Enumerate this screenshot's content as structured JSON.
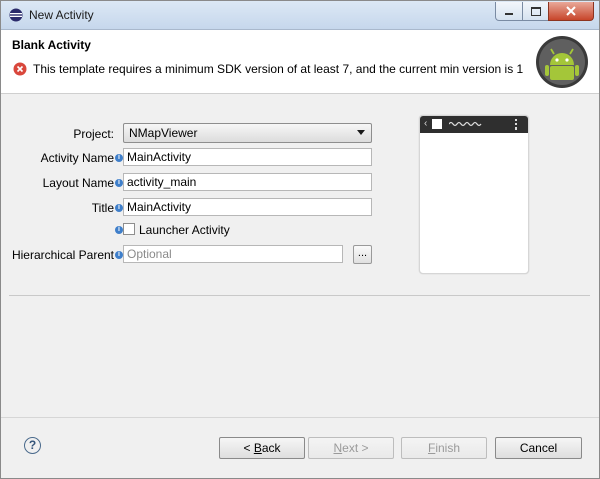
{
  "window": {
    "title": "New Activity"
  },
  "header": {
    "title": "Blank Activity",
    "error_message": "This template requires a minimum SDK version of at least 7, and the current min version is 1"
  },
  "form": {
    "project_label": "Project:",
    "project_value": "NMapViewer",
    "activity_name_label": "Activity Name",
    "activity_name_value": "MainActivity",
    "layout_name_label": "Layout Name",
    "layout_name_value": "activity_main",
    "title_label": "Title",
    "title_value": "MainActivity",
    "launcher_label": "Launcher Activity",
    "launcher_checked": false,
    "hierarchical_parent_label": "Hierarchical Parent",
    "hierarchical_parent_placeholder": "Optional",
    "browse_label": "..."
  },
  "buttons": {
    "help": "?",
    "back_prefix": "< ",
    "back_mnemonic": "B",
    "back_rest": "ack",
    "next_prefix": "",
    "next_mnemonic": "N",
    "next_rest": "ext >",
    "finish_prefix": "",
    "finish_mnemonic": "F",
    "finish_rest": "inish",
    "cancel": "Cancel"
  },
  "icons": {
    "app": "eclipse-icon",
    "error": "error-icon",
    "info": "info-icon",
    "badge": "android-icon"
  },
  "colors": {
    "error_red": "#d9473c",
    "info_blue": "#3f7fca",
    "android_green": "#a4c639"
  }
}
